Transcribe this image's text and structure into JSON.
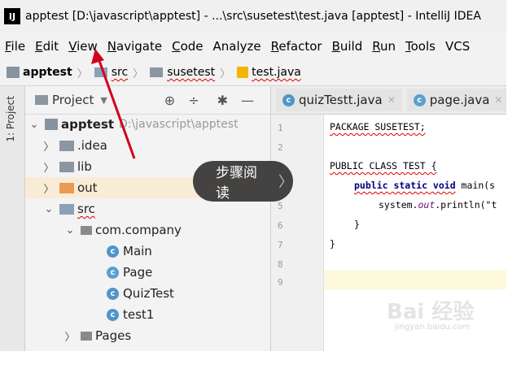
{
  "window": {
    "app_icon": "IJ",
    "title": "apptest [D:\\javascript\\apptest] - ...\\src\\susetest\\test.java [apptest] - IntelliJ IDEA"
  },
  "menu": [
    {
      "ul": "F",
      "rest": "ile"
    },
    {
      "ul": "E",
      "rest": "dit"
    },
    {
      "ul": "V",
      "rest": "iew"
    },
    {
      "ul": "N",
      "rest": "avigate"
    },
    {
      "ul": "C",
      "rest": "ode"
    },
    {
      "ul": "",
      "rest": "Analyze"
    },
    {
      "ul": "R",
      "rest": "efactor"
    },
    {
      "ul": "B",
      "rest": "uild"
    },
    {
      "ul": "R",
      "rest": "un"
    },
    {
      "ul": "T",
      "rest": "ools"
    },
    {
      "ul": "",
      "rest": "VCS"
    }
  ],
  "breadcrumb": {
    "project": "apptest",
    "src": "src",
    "pkg": "susetest",
    "file": "test.java"
  },
  "side_strip": {
    "label": "1: Project"
  },
  "project_panel": {
    "title": "Project",
    "icons": [
      "target-icon",
      "collapse-icon",
      "gear-icon",
      "minimize-icon"
    ]
  },
  "tree": {
    "root": {
      "name": "apptest",
      "path": "D:\\javascript\\apptest"
    },
    "idea": ".idea",
    "lib": "lib",
    "out": "out",
    "src": "src",
    "company": "com.company",
    "main": "Main",
    "page": "Page",
    "quiztest": "QuizTest",
    "test1": "test1",
    "pages": "Pages"
  },
  "tabs": [
    {
      "label": "quizTestt.java"
    },
    {
      "label": "page.java"
    }
  ],
  "editor": {
    "line_numbers": [
      "1",
      "2",
      "3",
      "4",
      "5",
      "6",
      "7",
      "8",
      "9"
    ],
    "line1": "PACKAGE SUSETEST;",
    "line3": "PUBLIC CLASS TEST {",
    "line4_kw": "public static void",
    "line4_rest": " main(s",
    "line5_a": "system.",
    "line5_b": "out",
    "line5_c": ".println(\"t",
    "line6": "}",
    "line7": "}"
  },
  "overlay": {
    "step_button": "步骤阅读",
    "chevron": "〉"
  },
  "watermark": {
    "main": "Bai 经验",
    "sub": "jingyan.baidu.com"
  },
  "colors": {
    "accent": "#d0021b",
    "highlight": "#fcf9dd",
    "keyword": "#000080"
  }
}
